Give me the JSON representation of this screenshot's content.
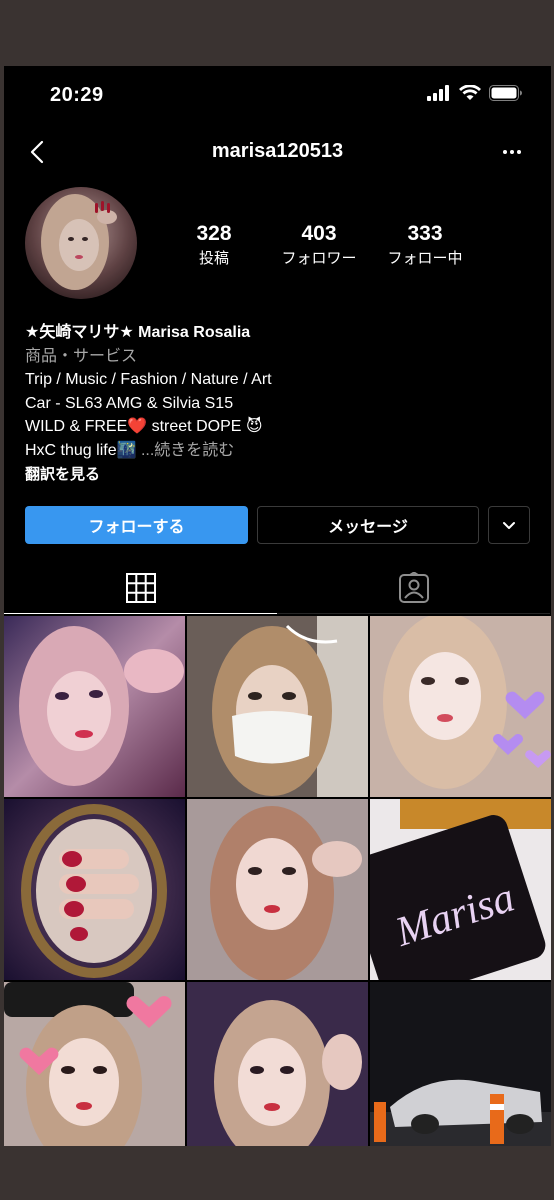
{
  "status_bar": {
    "time": "20:29"
  },
  "header": {
    "username": "marisa120513"
  },
  "stats": [
    {
      "value": "328",
      "label": "投稿"
    },
    {
      "value": "403",
      "label": "フォロワー"
    },
    {
      "value": "333",
      "label": "フォロー中"
    }
  ],
  "bio": {
    "name": "★矢崎マリサ★ Marisa Rosalia",
    "category": "商品・サービス",
    "line1": "Trip / Music / Fashion / Nature / Art",
    "line2": "Car - SL63 AMG & Silvia S15",
    "line3": "WILD & FREE❤️  street DOPE 😈",
    "line4": "HxC thug life🌃",
    "more": "...続きを読む",
    "translate": "翻訳を見る"
  },
  "buttons": {
    "follow": "フォローする",
    "message": "メッセージ"
  },
  "grid_posts": [
    {
      "text": ""
    },
    {
      "text": ""
    },
    {
      "text": ""
    },
    {
      "text": ""
    },
    {
      "text": ""
    },
    {
      "text": "Marisa"
    },
    {
      "text": ""
    },
    {
      "text": ""
    },
    {
      "text": ""
    }
  ],
  "colors": {
    "background": "#000000",
    "follow_button": "#3897f0",
    "secondary_text": "#a8a8a8"
  }
}
